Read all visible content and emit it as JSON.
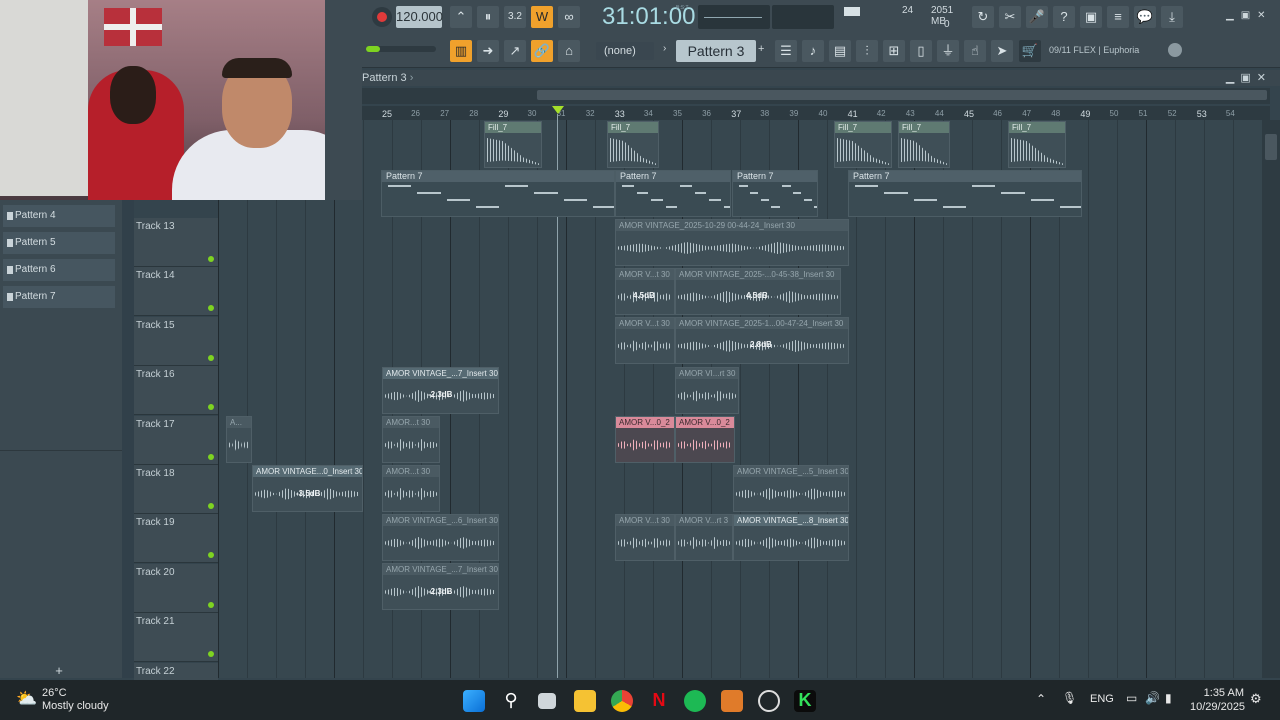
{
  "toolbar": {
    "tempo": "120.000",
    "time": "31:01:00",
    "bst": "B:S:T",
    "cpu_value": "24",
    "memory": "2051 MB",
    "polyphony": "0",
    "pattern_none": "(none)",
    "pattern": "Pattern 3",
    "news": "09/11  FLEX | Euphoria"
  },
  "playlist": {
    "title": "Pattern 3",
    "ruler": [
      "25",
      "26",
      "27",
      "28",
      "29",
      "30",
      "31",
      "32",
      "33",
      "34",
      "35",
      "36",
      "37",
      "38",
      "39",
      "40",
      "41",
      "42",
      "43",
      "44",
      "45",
      "46",
      "47",
      "48",
      "49",
      "50",
      "51",
      "52",
      "53",
      "54"
    ],
    "tracks": [
      "Track 13",
      "Track 14",
      "Track 15",
      "Track 16",
      "Track 17",
      "Track 18",
      "Track 19",
      "Track 20",
      "Track 21",
      "Track 22"
    ],
    "clips": [
      {
        "label": "Fill_7"
      },
      {
        "label": "Fill_7"
      },
      {
        "label": "Fill_7"
      },
      {
        "label": "Fill_7"
      },
      {
        "label": "Fill_7"
      },
      {
        "label": "Pattern 7"
      },
      {
        "label": "Pattern 7"
      },
      {
        "label": "Pattern 7"
      },
      {
        "label": "Pattern 7"
      },
      {
        "label": "AMOR VINTAGE_2025-10-29 00-44-24_Insert 30"
      },
      {
        "label": "AMOR V...t 30"
      },
      {
        "label": "AMOR VINTAGE_2025-...0-45-38_Insert 30"
      },
      {
        "label": "AMOR V...t 30"
      },
      {
        "label": "AMOR VINTAGE_2025-1...00-47-24_Insert 30"
      },
      {
        "label": "AMOR VINTAGE_...7_Insert 30"
      },
      {
        "label": "AMOR VI...rt 30"
      },
      {
        "label": "A..."
      },
      {
        "label": "AMOR...t 30"
      },
      {
        "label": "AMOR V...0_2"
      },
      {
        "label": "AMOR V...0_2"
      },
      {
        "label": "AMOR VINTAGE...0_Insert 30"
      },
      {
        "label": "AMOR...t 30"
      },
      {
        "label": "AMOR VINTAGE_...5_Insert 30"
      },
      {
        "label": "AMOR VINTAGE_...6_Insert 30"
      },
      {
        "label": "AMOR V...t 30"
      },
      {
        "label": "AMOR V...rt 3"
      },
      {
        "label": "AMOR VINTAGE_...8_Insert 30"
      },
      {
        "label": "AMOR VINTAGE_...7_Insert 30"
      }
    ],
    "gains": [
      "4.5dB",
      "4.5dB",
      "2.8dB",
      "-2.3dB",
      "-3.5dB",
      "-2.3dB"
    ]
  },
  "browser": {
    "items": [
      "Pattern 4",
      "Pattern 5",
      "Pattern 6",
      "Pattern 7"
    ],
    "add": "+"
  },
  "taskbar": {
    "temp": "26°C",
    "weather": "Mostly cloudy",
    "lang": "ENG",
    "time": "1:35 AM",
    "date": "10/29/2025"
  }
}
